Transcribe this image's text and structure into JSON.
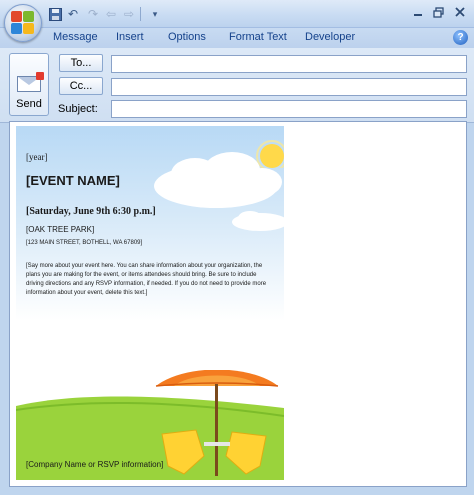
{
  "ribbon": {
    "tabs": [
      "Message",
      "Insert",
      "Options",
      "Format Text",
      "Developer"
    ]
  },
  "header": {
    "send_label": "Send",
    "to_label": "To...",
    "cc_label": "Cc...",
    "subject_label": "Subject:",
    "to_value": "",
    "cc_value": "",
    "subject_value": ""
  },
  "flyer": {
    "year": "[year]",
    "event_name": "[EVENT NAME]",
    "datetime": "[Saturday, June 9th 6:30 p.m.]",
    "venue": "[OAK TREE PARK]",
    "address": "[123 MAIN STREET, BOTHELL, WA 67809]",
    "description_lines": [
      "[Say more about your event here. You can share information about your organization, the",
      "plans you are making for the event, or items attendees should bring.  Be sure to include",
      "driving directions and any RSVP information, if needed. If you do not need to provide more",
      "information about your event, delete this text.]"
    ],
    "footer": "[Company Name or RSVP information]"
  },
  "colors": {
    "accent": "#15428b",
    "sky": "#b8d9f5",
    "grass": "#9ad33c",
    "umbrella": "#f47b20"
  }
}
